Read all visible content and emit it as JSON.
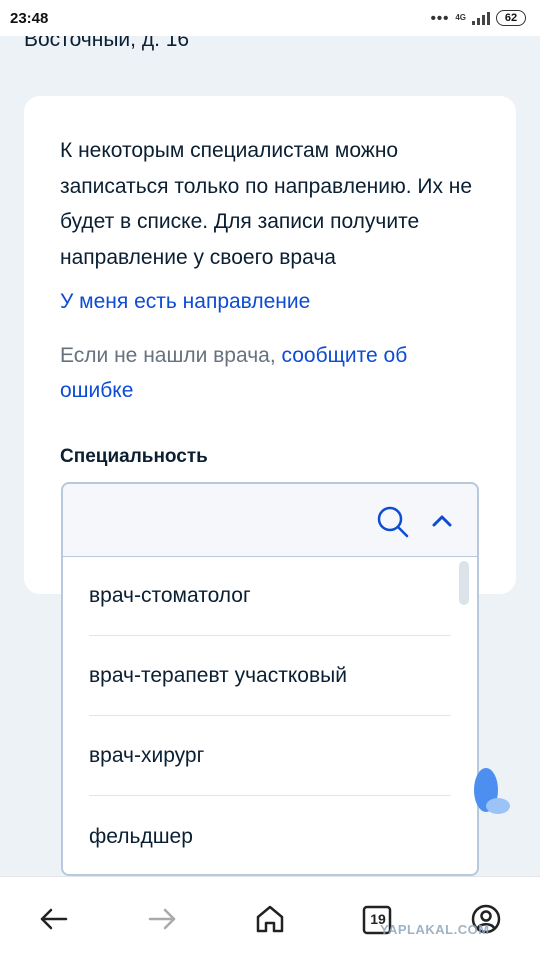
{
  "status_bar": {
    "time": "23:48",
    "network": "4G",
    "battery": "62"
  },
  "address_partial": "Восточный, д. 16",
  "info": {
    "text": "К некоторым специалистам можно записаться только по направлению. Их не будет в списке. Для записи получите направление у своего врача",
    "referral_link": "У меня есть направление",
    "report_prefix": "Если не нашли врача, ",
    "report_link": "сообщите об ошибке"
  },
  "specialty": {
    "label": "Специальность",
    "value": "",
    "options": [
      "врач-стоматолог",
      "врач-терапевт участковый",
      "врач-хирург",
      "фельдшер"
    ]
  },
  "browser_nav": {
    "tabs_count": "19"
  },
  "watermark": "YAPLAKAL.COM",
  "colors": {
    "link": "#0d4cd3",
    "text": "#0b1f33",
    "muted": "#66727f",
    "background": "#edf2f7",
    "field_border": "#b8c8dd"
  },
  "icons": [
    "search-icon",
    "chevron-up-icon",
    "back-arrow-icon",
    "forward-arrow-icon",
    "home-icon",
    "tabs-icon",
    "profile-icon"
  ]
}
